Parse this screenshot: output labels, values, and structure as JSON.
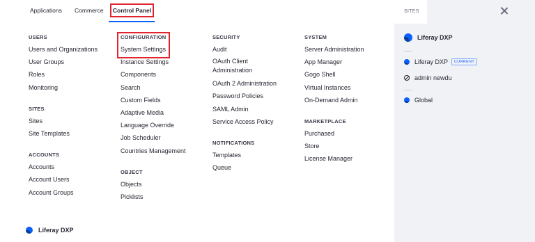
{
  "tabs": [
    {
      "label": "Applications"
    },
    {
      "label": "Commerce"
    },
    {
      "label": "Control Panel"
    }
  ],
  "columns": {
    "users": {
      "heading": "USERS",
      "items": [
        "Users and Organizations",
        "User Groups",
        "Roles",
        "Monitoring"
      ]
    },
    "sites": {
      "heading": "SITES",
      "items": [
        "Sites",
        "Site Templates"
      ]
    },
    "accounts": {
      "heading": "ACCOUNTS",
      "items": [
        "Accounts",
        "Account Users",
        "Account Groups"
      ]
    },
    "configuration": {
      "heading": "CONFIGURATION",
      "items": [
        "System Settings",
        "Instance Settings",
        "Components",
        "Search",
        "Custom Fields",
        "Adaptive Media",
        "Language Override",
        "Job Scheduler",
        "Countries Management"
      ]
    },
    "object": {
      "heading": "OBJECT",
      "items": [
        "Objects",
        "Picklists"
      ]
    },
    "security": {
      "heading": "SECURITY",
      "items": [
        "Audit",
        "OAuth Client Administration",
        "OAuth 2 Administration",
        "Password Policies",
        "SAML Admin",
        "Service Access Policy"
      ]
    },
    "notifications": {
      "heading": "NOTIFICATIONS",
      "items": [
        "Templates",
        "Queue"
      ]
    },
    "system": {
      "heading": "SYSTEM",
      "items": [
        "Server Administration",
        "App Manager",
        "Gogo Shell",
        "Virtual Instances",
        "On-Demand Admin"
      ]
    },
    "marketplace": {
      "heading": "MARKETPLACE",
      "items": [
        "Purchased",
        "Store",
        "License Manager"
      ]
    }
  },
  "footer": {
    "brand": "Liferay DXP"
  },
  "sidebar": {
    "tab_label": "SITES",
    "main_site": "Liferay DXP",
    "sites": [
      {
        "label": "Liferay DXP",
        "badge": "CURRENT"
      },
      {
        "label": "admin newdu"
      },
      {
        "label": "Global"
      }
    ]
  },
  "colors": {
    "accent": "#0b5fff",
    "highlight": "#e0252f",
    "sidebar_bg": "#f1f2f5"
  }
}
